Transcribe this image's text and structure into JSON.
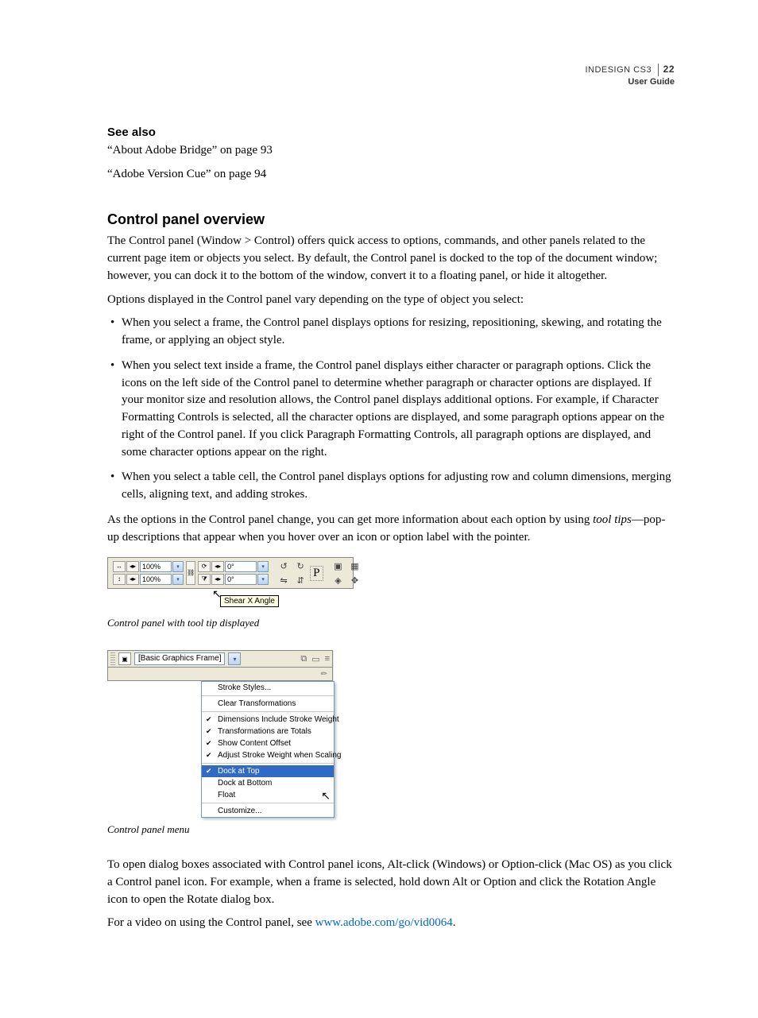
{
  "header": {
    "product": "INDESIGN CS3",
    "doc": "User Guide",
    "page": "22"
  },
  "see_also": {
    "heading": "See also",
    "refs": [
      "“About Adobe Bridge” on page 93",
      "“Adobe Version Cue” on page 94"
    ]
  },
  "section": {
    "title": "Control panel overview",
    "p1": "The Control panel (Window > Control) offers quick access to options, commands, and other panels related to the current page item or objects you select. By default, the Control panel is docked to the top of the document window; however, you can dock it to the bottom of the window, convert it to a floating panel, or hide it altogether.",
    "p2": "Options displayed in the Control panel vary depending on the type of object you select:",
    "bullets": [
      "When you select a frame, the Control panel displays options for resizing, repositioning, skewing, and rotating the frame, or applying an object style.",
      "When you select text inside a frame, the Control panel displays either character or paragraph options. Click the icons on the left side of the Control panel to determine whether paragraph or character options are displayed. If your monitor size and resolution allows, the Control panel displays additional options. For example, if Character Formatting Controls is selected, all the character options are displayed, and some paragraph options appear on the right of the Control panel. If you click Paragraph Formatting Controls, all paragraph options are displayed, and some character options appear on the right.",
      "When you select a table cell, the Control panel displays options for adjusting row and column dimensions, merging cells, aligning text, and adding strokes."
    ],
    "p3a": "As the options in the Control panel change, you can get more information about each option by using ",
    "p3_em": "tool tips",
    "p3b": "—pop-up descriptions that appear when you hover over an icon or option label with the pointer.",
    "caption1": "Control panel with tool tip displayed",
    "caption2": "Control panel menu",
    "p4": "To open dialog boxes associated with Control panel icons, Alt-click (Windows) or Option-click (Mac OS) as you click a Control panel icon. For example, when a frame is selected, hold down Alt or Option and click the Rotation Angle icon to open the Rotate dialog box.",
    "p5a": "For a video on using the Control panel, see ",
    "link": "www.adobe.com/go/vid0064",
    "p5b": "."
  },
  "fig1": {
    "scaleX": "100%",
    "scaleY": "100%",
    "rot": "0°",
    "shear": "0°",
    "tooltip": "Shear X Angle"
  },
  "fig2": {
    "style": "[Basic Graphics Frame]",
    "menu": [
      {
        "label": "Stroke Styles...",
        "checked": false
      },
      {
        "label": "Clear Transformations",
        "checked": false
      },
      {
        "label": "Dimensions Include Stroke Weight",
        "checked": true
      },
      {
        "label": "Transformations are Totals",
        "checked": true
      },
      {
        "label": "Show Content Offset",
        "checked": true
      },
      {
        "label": "Adjust Stroke Weight when Scaling",
        "checked": true
      },
      {
        "label": "Dock at Top",
        "checked": true,
        "highlight": true
      },
      {
        "label": "Dock at Bottom",
        "checked": false
      },
      {
        "label": "Float",
        "checked": false
      },
      {
        "label": "Customize...",
        "checked": false
      }
    ]
  }
}
